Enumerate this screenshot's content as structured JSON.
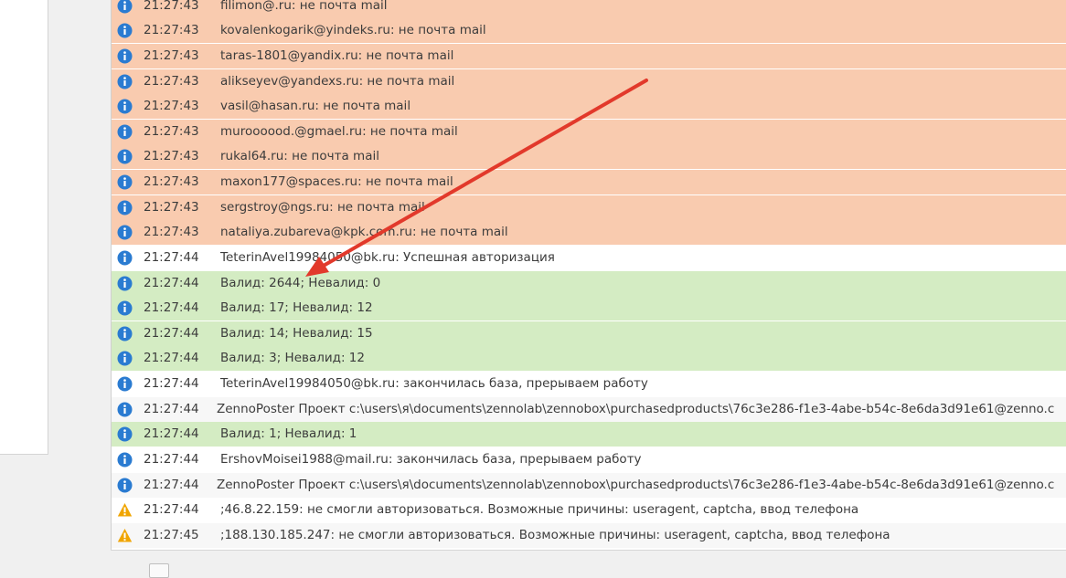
{
  "colors": {
    "error_row": "#f9cbaf",
    "success_row": "#d4ecc3",
    "info_icon": "#2a7bd1",
    "warning_icon": "#f0a500",
    "annotation_arrow": "#e2392b"
  },
  "log": {
    "rows": [
      {
        "icon": "info-icon",
        "time": "21:27:43",
        "message": "filimon@.ru: не почта mail"
      },
      {
        "icon": "info-icon",
        "time": "21:27:43",
        "message": "kovalenkogarik@yindeks.ru: не почта mail"
      },
      {
        "icon": "info-icon",
        "time": "21:27:43",
        "message": "taras-1801@yandix.ru: не почта mail"
      },
      {
        "icon": "info-icon",
        "time": "21:27:43",
        "message": "alikseyev@yandexs.ru: не почта mail"
      },
      {
        "icon": "info-icon",
        "time": "21:27:43",
        "message": "vasil@hasan.ru: не почта mail"
      },
      {
        "icon": "info-icon",
        "time": "21:27:43",
        "message": "muroooood.@gmael.ru: не почта mail"
      },
      {
        "icon": "info-icon",
        "time": "21:27:43",
        "message": "rukal64.ru: не почта mail"
      },
      {
        "icon": "info-icon",
        "time": "21:27:43",
        "message": "maxon177@spaces.ru: не почта mail"
      },
      {
        "icon": "info-icon",
        "time": "21:27:43",
        "message": "sergstroy@ngs.ru: не почта mail"
      },
      {
        "icon": "info-icon",
        "time": "21:27:43",
        "message": "nataliya.zubareva@kpk.com.ru: не почта mail"
      },
      {
        "icon": "info-icon",
        "time": "21:27:44",
        "message": "TeterinAvel19984050@bk.ru: Успешная авторизация"
      },
      {
        "icon": "info-icon",
        "time": "21:27:44",
        "message": "Валид: 2644; Невалид: 0"
      },
      {
        "icon": "info-icon",
        "time": "21:27:44",
        "message": "Валид: 17; Невалид: 12"
      },
      {
        "icon": "info-icon",
        "time": "21:27:44",
        "message": "Валид: 14; Невалид: 15"
      },
      {
        "icon": "info-icon",
        "time": "21:27:44",
        "message": "Валид: 3; Невалид: 12"
      },
      {
        "icon": "info-icon",
        "time": "21:27:44",
        "message": "TeterinAvel19984050@bk.ru: закончилась база, прерываем работу"
      },
      {
        "icon": "info-icon",
        "time": "21:27:44",
        "message": "ZennoPoster Проект c:\\users\\я\\documents\\zennolab\\zennobox\\purchasedproducts\\76c3e286-f1e3-4abe-b54c-8e6da3d91e61@zenno.c"
      },
      {
        "icon": "info-icon",
        "time": "21:27:44",
        "message": "Валид: 1; Невалид: 1"
      },
      {
        "icon": "info-icon",
        "time": "21:27:44",
        "message": "ErshovMoisei1988@mail.ru: закончилась база, прерываем работу"
      },
      {
        "icon": "info-icon",
        "time": "21:27:44",
        "message": "ZennoPoster Проект c:\\users\\я\\documents\\zennolab\\zennobox\\purchasedproducts\\76c3e286-f1e3-4abe-b54c-8e6da3d91e61@zenno.c"
      },
      {
        "icon": "warning-icon",
        "time": "21:27:44",
        "message": ";46.8.22.159: не смогли авторизоваться. Возможные причины: useragent, captcha, ввод телефона"
      },
      {
        "icon": "warning-icon",
        "time": "21:27:45",
        "message": ";188.130.185.247: не смогли авторизоваться. Возможные причины: useragent, captcha, ввод телефона"
      }
    ]
  }
}
